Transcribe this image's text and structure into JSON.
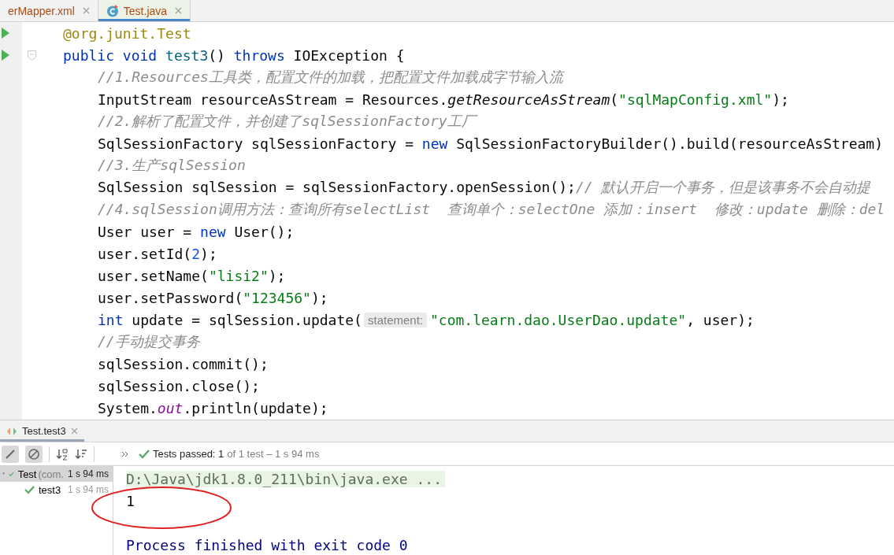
{
  "editor_tabs": [
    {
      "label": "erMapper.xml",
      "kind": "xml",
      "selected": false
    },
    {
      "label": "Test.java",
      "kind": "java",
      "selected": true
    }
  ],
  "code_lines": [
    {
      "indented": false,
      "run_icon": true,
      "fold": false,
      "segments": [
        {
          "kind": "code",
          "tokens": [
            {
              "kind": "ann",
              "t": "@org.junit.Test"
            }
          ]
        }
      ]
    },
    {
      "indented": false,
      "run_icon": true,
      "fold": true,
      "segments": [
        {
          "kind": "code",
          "tokens": [
            {
              "kind": "kw",
              "t": "public void "
            },
            {
              "kind": "fn",
              "t": "test3"
            },
            {
              "kind": "plain",
              "t": "() "
            },
            {
              "kind": "kw",
              "t": "throws "
            },
            {
              "kind": "plain",
              "t": "IOException {"
            }
          ]
        }
      ]
    },
    {
      "indented": true,
      "run_icon": false,
      "fold": false,
      "segments": [
        {
          "kind": "code",
          "tokens": [
            {
              "kind": "comment",
              "t": "//1.Resources工具类，配置文件的加载，把配置文件加载成字节输入流"
            }
          ]
        }
      ]
    },
    {
      "indented": true,
      "run_icon": false,
      "fold": false,
      "segments": [
        {
          "kind": "code",
          "tokens": [
            {
              "kind": "plain",
              "t": "InputStream resourceAsStream = Resources."
            },
            {
              "kind": "static",
              "t": "getResourceAsStream"
            },
            {
              "kind": "plain",
              "t": "("
            },
            {
              "kind": "str",
              "t": "\"sqlMapConfig.xml\""
            },
            {
              "kind": "plain",
              "t": ");"
            }
          ]
        }
      ]
    },
    {
      "indented": true,
      "run_icon": false,
      "fold": false,
      "segments": [
        {
          "kind": "code",
          "tokens": [
            {
              "kind": "comment",
              "t": "//2.解析了配置文件，并创建了sqlSessionFactory工厂"
            }
          ]
        }
      ]
    },
    {
      "indented": true,
      "run_icon": false,
      "fold": false,
      "segments": [
        {
          "kind": "code",
          "tokens": [
            {
              "kind": "plain",
              "t": "SqlSessionFactory sqlSessionFactory = "
            },
            {
              "kind": "kw",
              "t": "new "
            },
            {
              "kind": "plain",
              "t": "SqlSessionFactoryBuilder().build(resourceAsStream)"
            }
          ]
        }
      ]
    },
    {
      "indented": true,
      "run_icon": false,
      "fold": false,
      "segments": [
        {
          "kind": "code",
          "tokens": [
            {
              "kind": "comment",
              "t": "//3.生产sqlSession"
            }
          ]
        }
      ]
    },
    {
      "indented": true,
      "run_icon": false,
      "fold": false,
      "segments": [
        {
          "kind": "code",
          "tokens": [
            {
              "kind": "plain",
              "t": "SqlSession sqlSession = sqlSessionFactory.openSession();"
            },
            {
              "kind": "comment",
              "t": "// 默认开启一个事务，但是该事务不会自动提"
            }
          ]
        }
      ]
    },
    {
      "indented": true,
      "run_icon": false,
      "fold": false,
      "segments": [
        {
          "kind": "code",
          "tokens": [
            {
              "kind": "comment",
              "t": "//4.sqlSession调用方法：查询所有selectList  查询单个：selectOne 添加：insert  修改：update 删除：del"
            }
          ]
        }
      ]
    },
    {
      "indented": true,
      "run_icon": false,
      "fold": false,
      "segments": [
        {
          "kind": "code",
          "tokens": [
            {
              "kind": "plain",
              "t": "User user = "
            },
            {
              "kind": "kw",
              "t": "new "
            },
            {
              "kind": "plain",
              "t": "User();"
            }
          ]
        }
      ]
    },
    {
      "indented": true,
      "run_icon": false,
      "fold": false,
      "segments": [
        {
          "kind": "code",
          "tokens": [
            {
              "kind": "plain",
              "t": "user.setId("
            },
            {
              "kind": "num",
              "t": "2"
            },
            {
              "kind": "plain",
              "t": ");"
            }
          ]
        }
      ]
    },
    {
      "indented": true,
      "run_icon": false,
      "fold": false,
      "segments": [
        {
          "kind": "code",
          "tokens": [
            {
              "kind": "plain",
              "t": "user.setName("
            },
            {
              "kind": "str",
              "t": "\"lisi2\""
            },
            {
              "kind": "plain",
              "t": ");"
            }
          ]
        }
      ]
    },
    {
      "indented": true,
      "run_icon": false,
      "fold": false,
      "segments": [
        {
          "kind": "code",
          "tokens": [
            {
              "kind": "plain",
              "t": "user.setPassword("
            },
            {
              "kind": "str",
              "t": "\"123456\""
            },
            {
              "kind": "plain",
              "t": ");"
            }
          ]
        }
      ]
    },
    {
      "indented": true,
      "run_icon": false,
      "fold": false,
      "segments": [
        {
          "kind": "code",
          "tokens": [
            {
              "kind": "kw",
              "t": "int "
            },
            {
              "kind": "plain",
              "t": "update = sqlSession.update("
            }
          ]
        },
        {
          "kind": "hint",
          "tokens": [
            {
              "kind": "plain",
              "t": "statement:"
            }
          ]
        },
        {
          "kind": "code",
          "tokens": [
            {
              "kind": "str",
              "t": "\"com.learn.dao.UserDao.update\""
            },
            {
              "kind": "plain",
              "t": ", user);"
            }
          ]
        }
      ]
    },
    {
      "indented": true,
      "run_icon": false,
      "fold": false,
      "segments": [
        {
          "kind": "code",
          "tokens": [
            {
              "kind": "comment",
              "t": "//手动提交事务"
            }
          ]
        }
      ]
    },
    {
      "indented": true,
      "run_icon": false,
      "fold": false,
      "segments": [
        {
          "kind": "code",
          "tokens": [
            {
              "kind": "plain",
              "t": "sqlSession.commit();"
            }
          ]
        }
      ]
    },
    {
      "indented": true,
      "run_icon": false,
      "fold": false,
      "segments": [
        {
          "kind": "code",
          "tokens": [
            {
              "kind": "plain",
              "t": "sqlSession.close();"
            }
          ]
        }
      ]
    },
    {
      "indented": true,
      "run_icon": false,
      "fold": false,
      "segments": [
        {
          "kind": "code",
          "tokens": [
            {
              "kind": "plain",
              "t": "System."
            },
            {
              "kind": "field",
              "t": "out"
            },
            {
              "kind": "plain",
              "t": ".println(update);"
            }
          ]
        }
      ]
    }
  ],
  "run_tabs": [
    {
      "label": "Test.test3",
      "selected": true
    }
  ],
  "status": {
    "passed": "Tests passed: 1",
    "detail": "of 1 test – 1 s 94 ms"
  },
  "test_tree": [
    {
      "label": "Test",
      "detail": "(com.",
      "time": "1 s 94 ms",
      "passed": true,
      "selected": true,
      "expanded": true,
      "children": [
        {
          "label": "test3",
          "time": "1 s 94 ms",
          "passed": true,
          "selected": false
        }
      ]
    }
  ],
  "console": [
    {
      "kind": "command",
      "text": "D:\\Java\\jdk1.8.0_211\\bin\\java.exe ..."
    },
    {
      "kind": "output",
      "text": "1"
    },
    {
      "kind": "blank"
    },
    {
      "kind": "exit",
      "text": "Process finished with exit code 0"
    }
  ]
}
